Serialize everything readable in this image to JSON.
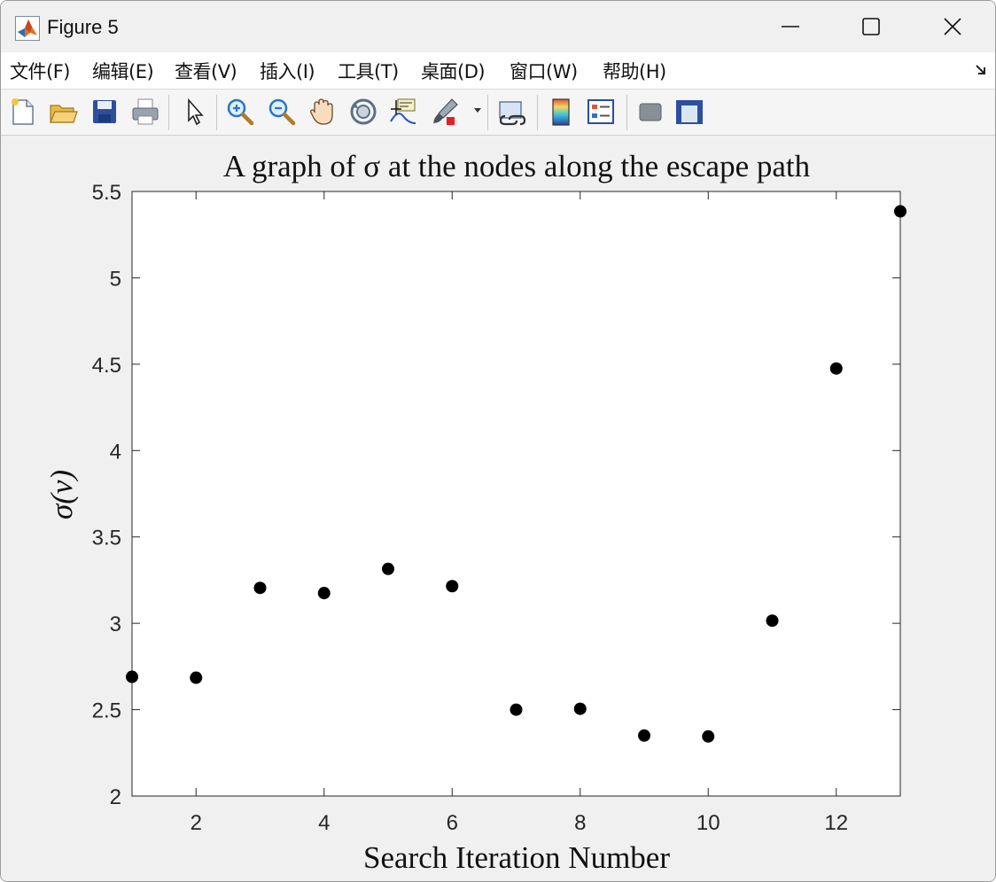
{
  "window": {
    "title": "Figure 5"
  },
  "menu": {
    "items": [
      "文件(F)",
      "编辑(E)",
      "查看(V)",
      "插入(I)",
      "工具(T)",
      "桌面(D)",
      "窗口(W)",
      "帮助(H)"
    ]
  },
  "toolbar": {
    "buttons": [
      {
        "name": "new-figure-icon"
      },
      {
        "name": "open-file-icon"
      },
      {
        "name": "save-icon"
      },
      {
        "name": "print-icon"
      },
      {
        "name": "edit-plot-arrow-icon"
      },
      {
        "name": "zoom-in-icon"
      },
      {
        "name": "zoom-out-icon"
      },
      {
        "name": "pan-hand-icon"
      },
      {
        "name": "rotate-3d-icon"
      },
      {
        "name": "data-cursor-icon"
      },
      {
        "name": "brush-icon"
      },
      {
        "name": "link-plot-icon"
      },
      {
        "name": "insert-colorbar-icon"
      },
      {
        "name": "insert-legend-icon"
      },
      {
        "name": "hide-plot-tools-icon"
      },
      {
        "name": "show-plot-tools-icon"
      }
    ]
  },
  "colors": {
    "marker": "#000000",
    "axes_background": "#ffffff",
    "figure_background": "#f0f0f0"
  },
  "chart_data": {
    "type": "scatter",
    "title": "A graph of σ at the nodes along the escape path",
    "xlabel": "Search Iteration Number",
    "ylabel": "σ(v)",
    "xlim": [
      1,
      13
    ],
    "ylim": [
      2,
      5.5
    ],
    "xticks": [
      2,
      4,
      6,
      8,
      10,
      12
    ],
    "yticks": [
      2,
      2.5,
      3,
      3.5,
      4,
      4.5,
      5,
      5.5
    ],
    "xtick_labels": [
      "2",
      "4",
      "6",
      "8",
      "10",
      "12"
    ],
    "ytick_labels": [
      "2",
      "2.5",
      "3",
      "3.5",
      "4",
      "4.5",
      "5",
      "5.5"
    ],
    "grid": false,
    "x": [
      1,
      2,
      3,
      4,
      5,
      6,
      7,
      8,
      9,
      10,
      11,
      12,
      13
    ],
    "y": [
      2.69,
      2.685,
      3.205,
      3.175,
      3.315,
      3.215,
      2.5,
      2.505,
      2.35,
      2.345,
      3.015,
      4.475,
      5.385
    ]
  }
}
